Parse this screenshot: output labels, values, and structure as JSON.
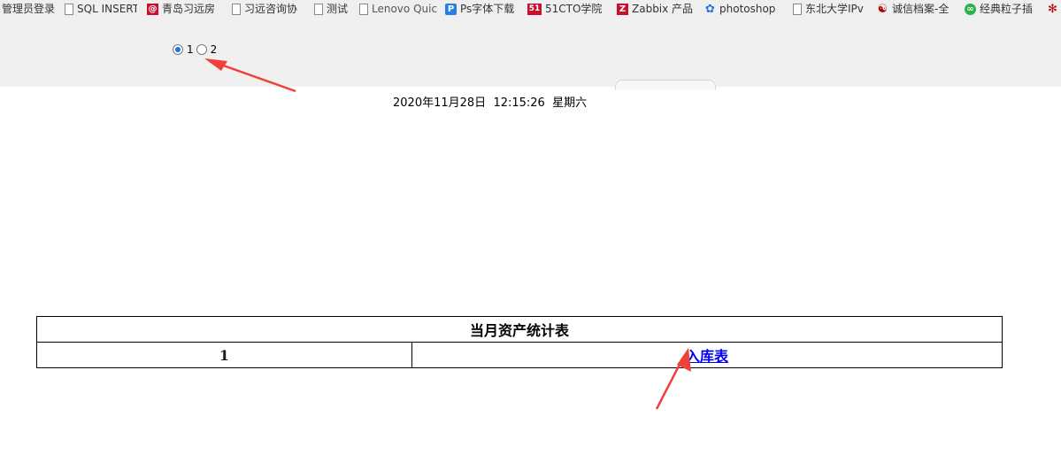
{
  "bookmarks": [
    {
      "label": "管理员登录",
      "icon": "none"
    },
    {
      "label": "SQL INSERT",
      "icon": "page-icon"
    },
    {
      "label": "青岛习远房",
      "icon": "at-icon"
    },
    {
      "label": "习远咨询协",
      "icon": "page-icon"
    },
    {
      "label": "测试",
      "icon": "page-icon"
    },
    {
      "label": "Lenovo Quic",
      "icon": "page-icon"
    },
    {
      "label": "Ps字体下载",
      "icon": "ps-icon"
    },
    {
      "label": "51CTO学院",
      "icon": "51cto-icon"
    },
    {
      "label": "Zabbix 产品",
      "icon": "zabbix-icon"
    },
    {
      "label": "photoshop",
      "icon": "baidu-paw-icon"
    },
    {
      "label": "东北大学IPv",
      "icon": "page-icon"
    },
    {
      "label": "诚信档案-全",
      "icon": "credit-icon"
    },
    {
      "label": "经典粒子插",
      "icon": "green-swirl-icon"
    }
  ],
  "radios": {
    "options": [
      "1",
      "2"
    ],
    "selected": "1"
  },
  "datetime": {
    "date": "2020年11月28日",
    "time": "12:15:26",
    "weekday": "星期六"
  },
  "table": {
    "title": "当月资产统计表",
    "row": {
      "number": "1",
      "link": "入库表"
    }
  },
  "colors": {
    "arrow": "#f0403a",
    "link": "#0000ee",
    "radio_accent": "#1a73e8"
  }
}
